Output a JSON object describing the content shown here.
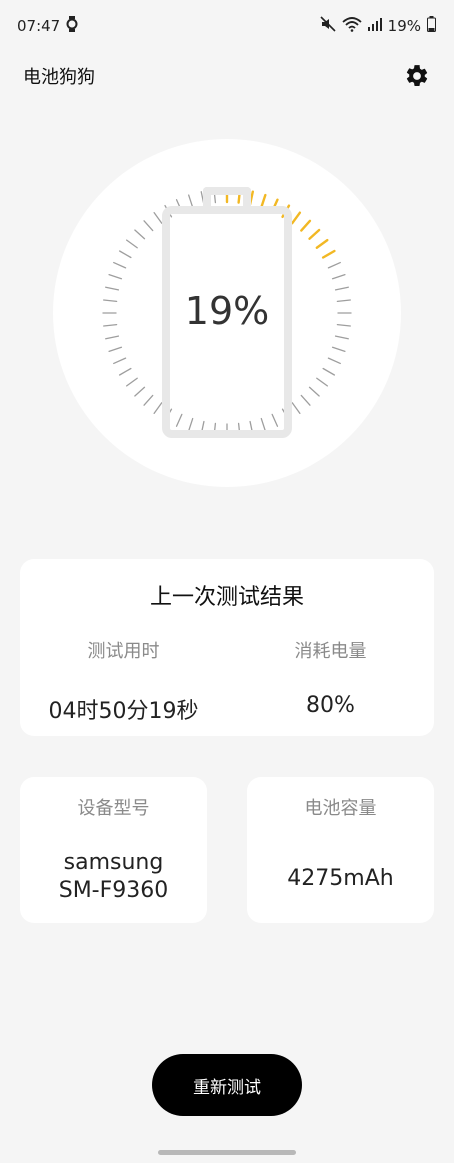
{
  "status_bar": {
    "time": "07:47",
    "battery_text": "19%",
    "icons": [
      "watch-icon",
      "mute-icon",
      "wifi-icon",
      "signal-icon",
      "battery-icon"
    ]
  },
  "app_bar": {
    "title": "电池狗狗",
    "settings_icon": "gear-icon"
  },
  "battery": {
    "percent_text": "19%",
    "level": 0.19,
    "accent_color": "#f2b824",
    "track_color": "#9e9e9e"
  },
  "last_test": {
    "title": "上一次测试结果",
    "duration_label": "测试用时",
    "duration_value": "04时50分19秒",
    "consumed_label": "消耗电量",
    "consumed_value": "80%"
  },
  "device": {
    "label": "设备型号",
    "value": "samsung\nSM-F9360"
  },
  "capacity": {
    "label": "电池容量",
    "value": "4275mAh"
  },
  "actions": {
    "retest_label": "重新测试"
  }
}
